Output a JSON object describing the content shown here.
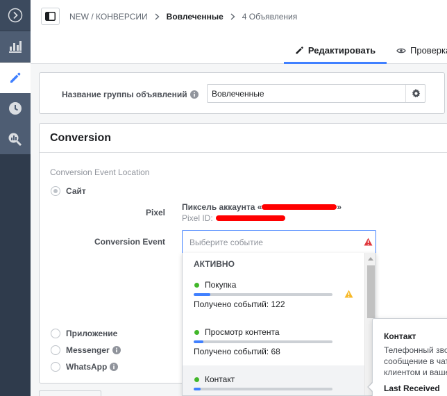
{
  "colors": {
    "rail_bg": "#2f3b4c",
    "rail_active_bg": "#ffffff",
    "accent": "#4080ff",
    "active_dot": "#42b72a",
    "warning": "#f7b928",
    "error": "#e0393e",
    "redaction": "#ff0000"
  },
  "rail": {
    "items": [
      {
        "icon": "chevron-right-circle-icon"
      },
      {
        "icon": "bar-chart-icon"
      },
      {
        "icon": "pencil-icon",
        "active": true
      },
      {
        "icon": "clock-icon"
      },
      {
        "icon": "search-chart-icon"
      }
    ]
  },
  "header": {
    "breadcrumbs": [
      "NEW / КОНВЕРСИИ",
      "Вовлеченные",
      "4 Объявления"
    ],
    "tabs": [
      {
        "label": "Редактировать",
        "icon": "pencil-icon",
        "active": true
      },
      {
        "label": "Проверка",
        "icon": "eye-icon",
        "active": false
      }
    ]
  },
  "ad_set": {
    "name_label": "Название группы объявлений",
    "name_value": "Вовлеченные"
  },
  "conversion": {
    "title": "Conversion",
    "location_label": "Conversion Event Location",
    "options": [
      {
        "label": "Сайт",
        "checked": true,
        "info": false
      },
      {
        "label": "Приложение",
        "checked": false,
        "info": false
      },
      {
        "label": "Messenger",
        "checked": false,
        "info": true
      },
      {
        "label": "WhatsApp",
        "checked": false,
        "info": true
      }
    ],
    "pixel_label": "Pixel",
    "pixel_name_prefix": "Пиксель аккаунта «",
    "pixel_name_suffix": "»",
    "pixel_id_prefix": "Pixel ID:",
    "event_label": "Conversion Event",
    "event_placeholder": "Выберите событие"
  },
  "dropdown": {
    "section": "АКТИВНО",
    "items": [
      {
        "name": "Покупка",
        "count_text": "Получено событий: 122",
        "fill": 0.12,
        "warning": true
      },
      {
        "name": "Просмотр контента",
        "count_text": "Получено событий: 68",
        "fill": 0.07,
        "warning": false
      },
      {
        "name": "Контакт",
        "count_text": "",
        "fill": 0.05,
        "warning": false
      }
    ]
  },
  "tooltip": {
    "title": "Контакт",
    "desc_lines": [
      "Телефонный зво",
      "сообщение в чат",
      "клиентом и ваше"
    ],
    "last_received": "Last Received"
  }
}
